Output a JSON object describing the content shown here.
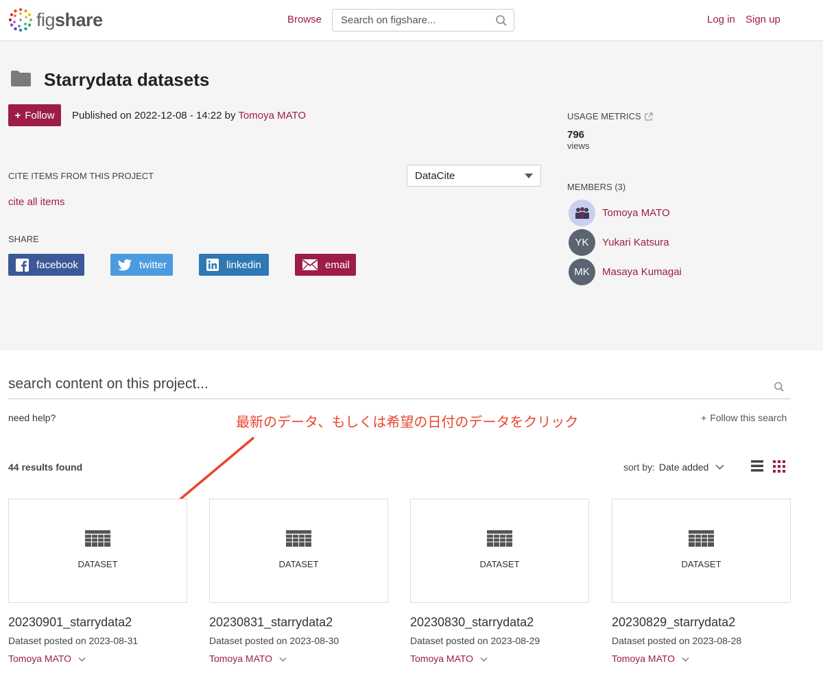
{
  "header": {
    "logo_text_light": "fig",
    "logo_text_bold": "share",
    "browse": "Browse",
    "search_placeholder": "Search on figshare...",
    "login": "Log in",
    "signup": "Sign up"
  },
  "project": {
    "title": "Starrydata datasets",
    "follow_label": "Follow",
    "published_prefix": "Published on 2022-12-08 - 14:22 by ",
    "published_author": "Tomoya MATO",
    "cite_label": "CITE ITEMS FROM THIS PROJECT",
    "cite_style": "DataCite",
    "cite_all": "cite all items",
    "share_label": "SHARE",
    "share": {
      "facebook": "facebook",
      "twitter": "twitter",
      "linkedin": "linkedin",
      "email": "email"
    }
  },
  "sidebar": {
    "usage_label": "USAGE METRICS",
    "views_count": "796",
    "views_label": "views",
    "members_label": "MEMBERS (3)",
    "members": [
      {
        "initials": "",
        "name": "Tomoya MATO"
      },
      {
        "initials": "YK",
        "name": "Yukari Katsura"
      },
      {
        "initials": "MK",
        "name": "Masaya Kumagai"
      }
    ]
  },
  "content": {
    "search_placeholder": "search content on this project...",
    "need_help": "need help?",
    "annotation": "最新のデータ、もしくは希望の日付のデータをクリック",
    "follow_search": "Follow this search",
    "results": "44 results found",
    "sort_label": "sort by:",
    "sort_value": "Date added"
  },
  "cards": [
    {
      "type": "DATASET",
      "title": "20230901_starrydata2",
      "date": "Dataset posted on 2023-08-31",
      "author": "Tomoya MATO"
    },
    {
      "type": "DATASET",
      "title": "20230831_starrydata2",
      "date": "Dataset posted on 2023-08-30",
      "author": "Tomoya MATO"
    },
    {
      "type": "DATASET",
      "title": "20230830_starrydata2",
      "date": "Dataset posted on 2023-08-29",
      "author": "Tomoya MATO"
    },
    {
      "type": "DATASET",
      "title": "20230829_starrydata2",
      "date": "Dataset posted on 2023-08-28",
      "author": "Tomoya MATO"
    }
  ],
  "colors": {
    "brand": "#9c1d48",
    "annotation": "#e8452e",
    "facebook": "#3b5998",
    "twitter": "#4a9be0",
    "linkedin": "#2f78b4"
  }
}
